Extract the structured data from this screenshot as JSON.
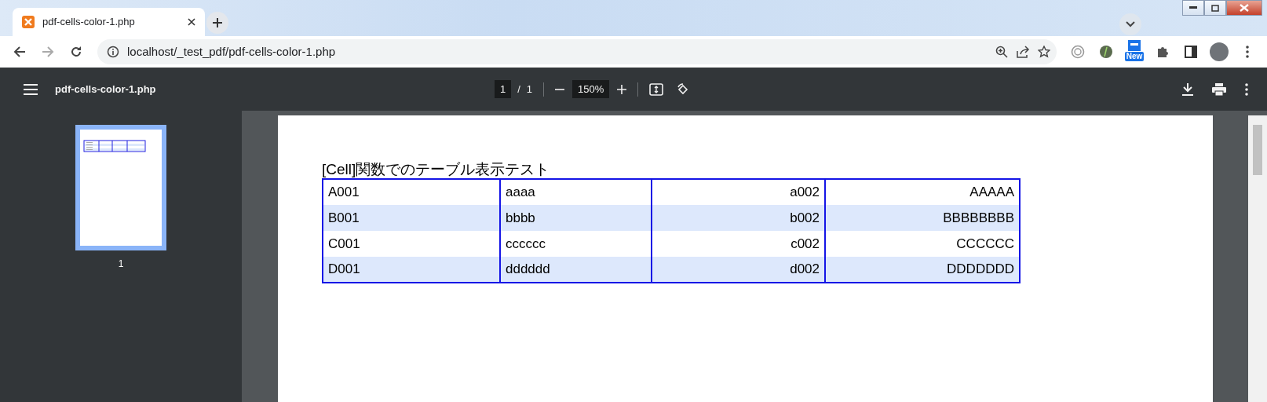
{
  "browser": {
    "tab_title": "pdf-cells-color-1.php",
    "url": "localhost/_test_pdf/pdf-cells-color-1.php",
    "extension_badge": "New"
  },
  "pdf_toolbar": {
    "title": "pdf-cells-color-1.php",
    "page_current": "1",
    "page_separator": "/",
    "page_total": "1",
    "zoom": "150%"
  },
  "thumbnails": [
    {
      "label": "1",
      "selected": true
    }
  ],
  "document": {
    "title": "[Cell]関数でのテーブル表示テスト",
    "rows": [
      {
        "shaded": false,
        "cells": [
          "A001",
          "aaaa",
          "a002",
          "AAAAA"
        ]
      },
      {
        "shaded": true,
        "cells": [
          "B001",
          "bbbb",
          "b002",
          "BBBBBBBB"
        ]
      },
      {
        "shaded": false,
        "cells": [
          "C001",
          "cccccc",
          "c002",
          "CCCCCC"
        ]
      },
      {
        "shaded": true,
        "cells": [
          "D001",
          "dddddd",
          "d002",
          "DDDDDDD"
        ]
      }
    ]
  }
}
